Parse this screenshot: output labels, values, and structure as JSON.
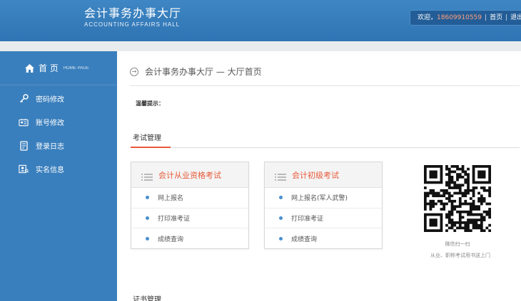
{
  "header": {
    "title_cn": "会计事务办事大厅",
    "title_en": "ACCOUNTING AFFAIRS HALL",
    "welcome": "欢迎，",
    "phone": "18609910559",
    "home_link": "首页",
    "logout_link": "退出"
  },
  "sidebar": {
    "home_label": "首 页",
    "home_en": "HOME PAGE",
    "items": [
      {
        "label": "密码修改",
        "icon": "key-icon"
      },
      {
        "label": "账号修改",
        "icon": "id-card-icon"
      },
      {
        "label": "登录日志",
        "icon": "log-icon"
      },
      {
        "label": "实名信息",
        "icon": "user-info-icon"
      }
    ]
  },
  "main": {
    "breadcrumb": "会计事务办事大厅 — 大厅首页",
    "tip_label": "温馨提示：",
    "section1": "考试管理",
    "cards": [
      {
        "title": "会计从业资格考试",
        "items": [
          "网上报名",
          "打印准考证",
          "成绩查询"
        ]
      },
      {
        "title": "会计初级考试",
        "items": [
          "网上报名(军人武警)",
          "打印准考证",
          "成绩查询"
        ]
      }
    ],
    "qr_caption1": "微信扫一扫",
    "qr_caption2": "从业、职称考试用书送上门",
    "section2": "证书管理"
  },
  "colors": {
    "header_blue": "#3479b8",
    "sidebar_blue": "#3a7fbd",
    "accent_red": "#e8593a",
    "dot_blue": "#4a8fd0"
  }
}
